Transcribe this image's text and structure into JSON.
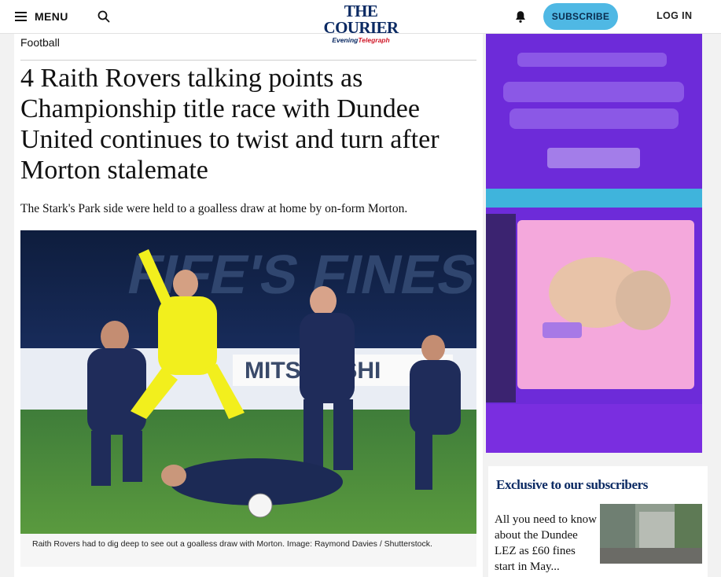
{
  "header": {
    "menu_label": "MENU",
    "logo_line1": "THE COURIER",
    "logo_line2_a": "Evening",
    "logo_line2_b": "Telegraph",
    "subscribe_label": "SUBSCRIBE",
    "login_label": "LOG IN",
    "icons": [
      "hamburger-icon",
      "search-icon",
      "bell-icon"
    ]
  },
  "article": {
    "category": "Football",
    "headline": "4 Raith Rovers talking points as Championship title race with Dundee United continues to twist and turn after Morton stalemate",
    "standfirst": "The Stark's Park side were held to a goalless draw at home by on-form Morton.",
    "image_caption": "Raith Rovers had to dig deep to see out a goalless draw with Morton. Image: Raymond Davies / Shutterstock."
  },
  "sidebar": {
    "exclusive_title": "Exclusive to our subscribers",
    "stories": [
      {
        "title": "All you need to know about the Dundee LEZ as £60 fines start in May..."
      }
    ]
  },
  "colors": {
    "brand_navy": "#0b2a63",
    "subscribe_bg": "#4fb8e4",
    "ad_purple": "#6d2bd9",
    "ad_pink": "#f4a8dc"
  }
}
